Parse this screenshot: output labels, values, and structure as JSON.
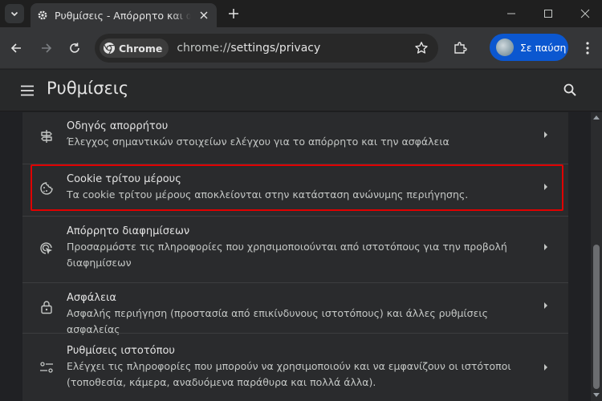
{
  "browser": {
    "tab_title": "Ρυθμίσεις - Απόρρητο και ασφάλεια",
    "omnibox": {
      "chip_label": "Chrome",
      "url_scheme": "chrome://",
      "url_path": "settings/privacy"
    },
    "profile_label": "Σε παύση"
  },
  "settings": {
    "title": "Ρυθμίσεις"
  },
  "privacy_items": [
    {
      "icon": "privacy-guide-icon",
      "title": "Οδηγός απορρήτου",
      "subtitle": "Έλεγχος σημαντικών στοιχείων ελέγχου για το απόρρητο και την ασφάλεια"
    },
    {
      "icon": "cookie-icon",
      "title": "Cookie τρίτου μέρους",
      "subtitle": "Τα cookie τρίτου μέρους αποκλείονται στην κατάσταση ανώνυμης περιήγησης."
    },
    {
      "icon": "ad-privacy-icon",
      "title": "Απόρρητο διαφημίσεων",
      "subtitle": "Προσαρμόστε τις πληροφορίες που χρησιμοποιούνται από ιστοτόπους για την προβολή διαφημίσεων"
    },
    {
      "icon": "lock-icon",
      "title": "Ασφάλεια",
      "subtitle": "Ασφαλής περιήγηση (προστασία από επικίνδυνους ιστοτόπους) και άλλες ρυθμίσεις ασφαλείας"
    },
    {
      "icon": "site-settings-icon",
      "title": "Ρυθμίσεις ιστοτόπου",
      "subtitle": "Ελέγχει τις πληροφορίες που μπορούν να χρησιμοποιούν και να εμφανίζουν οι ιστότοποι (τοποθεσία, κάμερα, αναδυόμενα παράθυρα και πολλά άλλα)."
    }
  ],
  "colors": {
    "highlight": "#e00000",
    "profile_button": "#0b57d0"
  }
}
